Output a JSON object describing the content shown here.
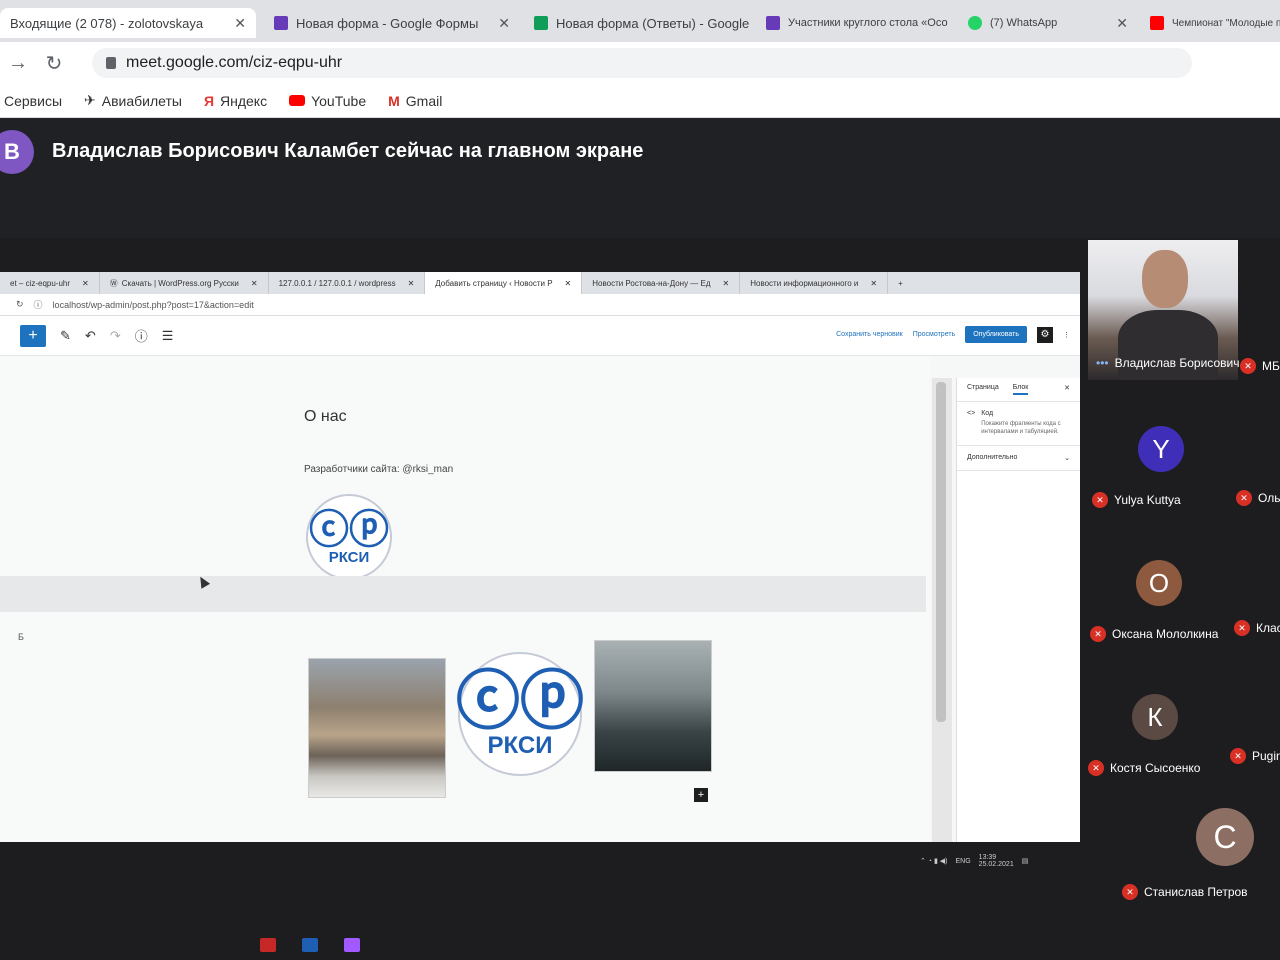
{
  "browser": {
    "tabs": [
      {
        "title": "Входящие (2 078) - zolotovskaya",
        "color": "#dfe1e5"
      },
      {
        "title": "Новая форма - Google Формы",
        "color": "#673ab7"
      },
      {
        "title": "Новая форма (Ответы) - Google",
        "color": "#0f9d58"
      },
      {
        "title": "Участники круглого стола «Осо",
        "color": "#673ab7"
      },
      {
        "title": "(7) WhatsApp",
        "color": "#25d366"
      },
      {
        "title": "Чемпионат \"Молодые профес",
        "color": "#ff0000"
      }
    ],
    "url": "meet.google.com/ciz-eqpu-uhr",
    "bookmarks": [
      "Сервисы",
      "Авиабилеты",
      "Яндекс",
      "YouTube",
      "Gmail"
    ]
  },
  "meet": {
    "presenter_initial": "В",
    "presenting_text": "Владислав Борисович Каламбет сейчас на главном экране"
  },
  "shared_screen": {
    "tabs": [
      "et – ciz-eqpu-uhr",
      "Скачать | WordPress.org Русски",
      "127.0.0.1 / 127.0.0.1 / wordpress",
      "Добавить страницу ‹ Новости Р",
      "Новости Ростова-на-Дону — Ед",
      "Новости информационного и"
    ],
    "url": "localhost/wp-admin/post.php?post=17&action=edit",
    "toolbar": {
      "save_draft": "Сохранить черновик",
      "preview": "Просмотреть",
      "publish": "Опубликовать"
    },
    "post_title": "О нас",
    "developers_text": "Разработчики сайта: @rksi_man",
    "logo_text": "РКСИ",
    "band_label": "Б",
    "sidebar": {
      "tab_page": "Страница",
      "tab_block": "Блок",
      "block_name": "Код",
      "block_desc": "Покажите фрагменты кода с интервалами и табуляцией.",
      "advanced": "Дополнительно"
    },
    "tray": {
      "lang": "ENG",
      "time": "13:39",
      "date": "25.02.2021"
    }
  },
  "participants": {
    "video": {
      "name": "Владислав Борисович..."
    },
    "cut_names": [
      "МБС",
      "Ольг",
      "Класс",
      "Pugino"
    ],
    "list": [
      {
        "initial": "Y",
        "name": "Yulya Kuttya",
        "color": "#3f2fb8"
      },
      {
        "initial": "О",
        "name": "Оксана Мололкина",
        "color": "#8d5a3f"
      },
      {
        "initial": "К",
        "name": "Костя Сысоенко",
        "color": "#5b4a43"
      },
      {
        "initial": "С",
        "name": "Станислав Петров",
        "color": "#8d6e63"
      }
    ]
  }
}
